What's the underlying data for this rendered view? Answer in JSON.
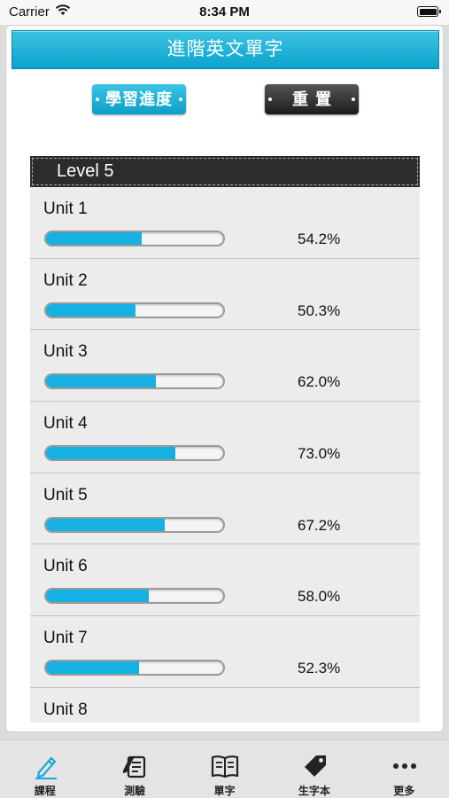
{
  "status_bar": {
    "carrier": "Carrier",
    "time": "8:34 PM"
  },
  "header": {
    "title": "進階英文單字"
  },
  "buttons": {
    "progress": "學習進度",
    "reset": "重置"
  },
  "level": {
    "label": "Level 5"
  },
  "units": [
    {
      "name": "Unit 1",
      "percent": "54.2%",
      "progress": 0.542
    },
    {
      "name": "Unit 2",
      "percent": "50.3%",
      "progress": 0.503
    },
    {
      "name": "Unit 3",
      "percent": "62.0%",
      "progress": 0.62
    },
    {
      "name": "Unit 4",
      "percent": "73.0%",
      "progress": 0.73
    },
    {
      "name": "Unit 5",
      "percent": "67.2%",
      "progress": 0.672
    },
    {
      "name": "Unit 6",
      "percent": "58.0%",
      "progress": 0.58
    },
    {
      "name": "Unit 7",
      "percent": "52.3%",
      "progress": 0.523
    },
    {
      "name": "Unit 8",
      "percent": "",
      "progress": null
    }
  ],
  "tabs": [
    {
      "label": "課程",
      "icon": "pencil-icon"
    },
    {
      "label": "測驗",
      "icon": "quiz-icon"
    },
    {
      "label": "單字",
      "icon": "book-icon"
    },
    {
      "label": "生字本",
      "icon": "tag-icon"
    },
    {
      "label": "更多",
      "icon": "more-icon"
    }
  ],
  "colors": {
    "accent": "#16b1e2",
    "active_tab": "#1aa7dc",
    "tab_icon": "#222222",
    "dark_button": "#2c2c2c"
  }
}
